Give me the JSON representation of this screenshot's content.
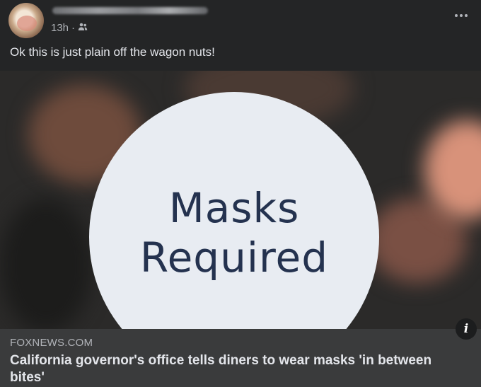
{
  "post": {
    "timestamp": "13h",
    "separator": "·",
    "audience_icon": "friends-icon",
    "text": "Ok this is just plain off the wagon nuts!"
  },
  "image": {
    "sign_lines": [
      "Masks",
      "Required"
    ],
    "sign_color": "#24324f"
  },
  "link": {
    "domain": "FOXNEWS.COM",
    "title": "California governor's office tells diners to wear masks 'in between bites'"
  },
  "icons": {
    "more": "more-options-icon",
    "info": "info-icon"
  },
  "colors": {
    "background": "#242526",
    "link_bar": "#3a3b3c",
    "primary_text": "#e4e6eb",
    "secondary_text": "#b0b3b8"
  }
}
